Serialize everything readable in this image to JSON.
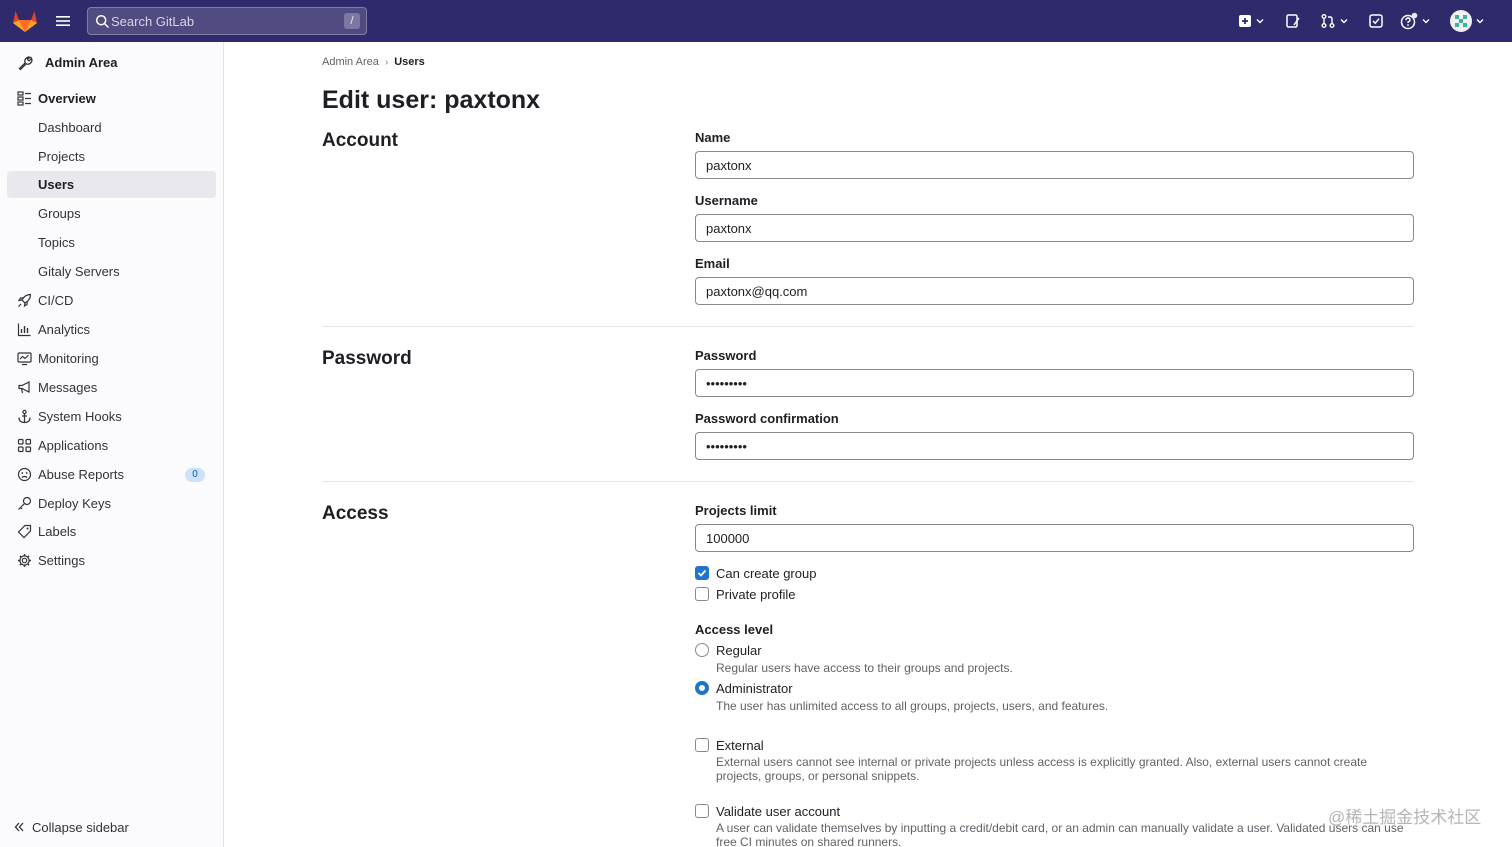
{
  "header": {
    "search_placeholder": "Search GitLab",
    "search_shortcut": "/"
  },
  "sidebar": {
    "context_title": "Admin Area",
    "items": [
      {
        "label": "Overview",
        "icon": "overview-icon",
        "section": true
      },
      {
        "label": "Dashboard"
      },
      {
        "label": "Projects"
      },
      {
        "label": "Users",
        "active": true
      },
      {
        "label": "Groups"
      },
      {
        "label": "Topics"
      },
      {
        "label": "Gitaly Servers"
      },
      {
        "label": "CI/CD",
        "icon": "rocket-icon"
      },
      {
        "label": "Analytics",
        "icon": "chart-icon"
      },
      {
        "label": "Monitoring",
        "icon": "monitor-icon"
      },
      {
        "label": "Messages",
        "icon": "bullhorn-icon"
      },
      {
        "label": "System Hooks",
        "icon": "anchor-icon"
      },
      {
        "label": "Applications",
        "icon": "applications-icon"
      },
      {
        "label": "Abuse Reports",
        "icon": "abuse-icon",
        "badge": "0"
      },
      {
        "label": "Deploy Keys",
        "icon": "key-icon"
      },
      {
        "label": "Labels",
        "icon": "label-icon"
      },
      {
        "label": "Settings",
        "icon": "settings-icon"
      }
    ],
    "collapse_label": "Collapse sidebar"
  },
  "breadcrumb": {
    "parent": "Admin Area",
    "current": "Users"
  },
  "page_title": "Edit user: paxtonx",
  "sections": {
    "account": {
      "title": "Account",
      "name_label": "Name",
      "name_value": "paxtonx",
      "username_label": "Username",
      "username_value": "paxtonx",
      "email_label": "Email",
      "email_value": "paxtonx@qq.com"
    },
    "password": {
      "title": "Password",
      "password_label": "Password",
      "password_value": "*********",
      "confirm_label": "Password confirmation",
      "confirm_value": "*********"
    },
    "access": {
      "title": "Access",
      "projects_limit_label": "Projects limit",
      "projects_limit_value": "100000",
      "can_create_group": "Can create group",
      "can_create_group_checked": true,
      "private_profile": "Private profile",
      "private_profile_checked": false,
      "access_level_label": "Access level",
      "regular_label": "Regular",
      "regular_help": "Regular users have access to their groups and projects.",
      "admin_label": "Administrator",
      "admin_help": "The user has unlimited access to all groups, projects, users, and features.",
      "selected_level": "Administrator",
      "external_label": "External",
      "external_help": "External users cannot see internal or private projects unless access is explicitly granted. Also, external users cannot create projects, groups, or personal snippets.",
      "validate_label": "Validate user account",
      "validate_help": "A user can validate themselves by inputting a credit/debit card, or an admin can manually validate a user. Validated users can use free CI minutes on shared runners."
    }
  },
  "watermark": "@稀土掘金技术社区",
  "colors": {
    "topbar": "#2f2a6b",
    "accent": "#1f75cb",
    "sidebar_bg": "#fbfafd"
  }
}
